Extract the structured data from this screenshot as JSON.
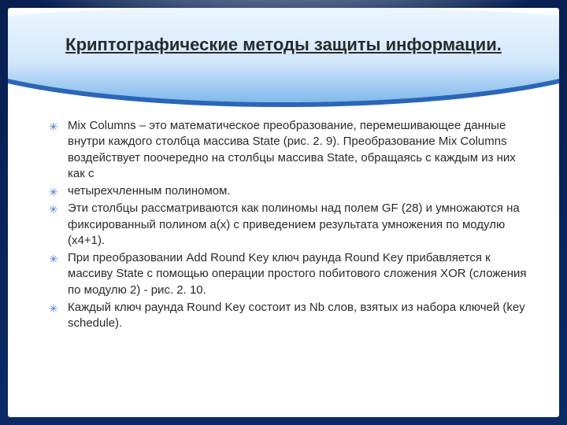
{
  "slide": {
    "title": "Криптографические методы защиты информации.",
    "bullets": [
      "Mix Columns  –  это  математическое  преобразование, перемешивающее данные внутри каждого столбца массива State  (рис. 2. 9).  Преобразование Mix Columns  воздействует  поочередно на  столбцы  массива State, обращаясь  с  каждым  из  них  как  с",
      "четырехчленным полиномом.",
      "Эти столбцы рассматриваются как полиномы над полем GF (28) и умножаются  на  фиксированный  полином  a(x)  с  приведением результата умножения по модулю (x4+1).",
      "При  преобразовании Add Round Key   ключ  раунда Round Key прибавляется к  массиву State  с  помощью  операции  простого  побитового  сложения XOR (сложения  по  модулю 2) -   рис. 2. 10.",
      "Каждый  ключ  раунда Round Key  состоит  из Nb  слов,  взятых  из набора ключей (key schedule)."
    ]
  },
  "colors": {
    "wave_fill": "#cfe6fb",
    "wave_mid": "#7bb5ea",
    "wave_edge": "#2a66b8"
  }
}
